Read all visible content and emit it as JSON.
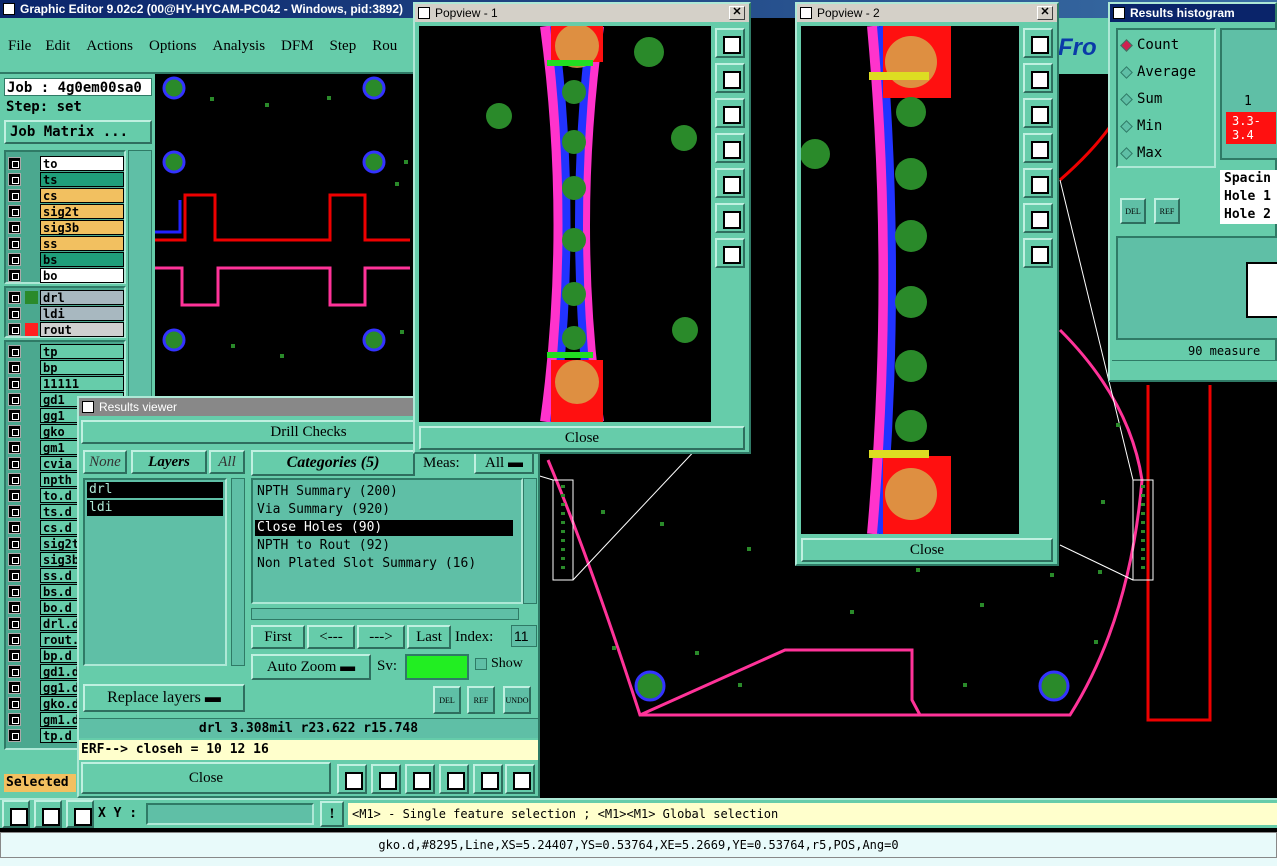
{
  "app": {
    "title": "Graphic Editor 9.02c2 (00@HY-HYCAM-PC042 - Windows, pid:3892)"
  },
  "menu": [
    "File",
    "Edit",
    "Actions",
    "Options",
    "Analysis",
    "DFM",
    "Step",
    "Rou"
  ],
  "job": {
    "label": "Job : 4g0em00sa0",
    "step": "Step: set",
    "matrix_btn": "Job Matrix ...",
    "logo": "Fro"
  },
  "layers_a": [
    {
      "name": "to",
      "color": "#ffffff"
    },
    {
      "name": "ts",
      "color": "#1f9e7a"
    },
    {
      "name": "cs",
      "color": "#f2c060"
    },
    {
      "name": "sig2t",
      "color": "#f2c060"
    },
    {
      "name": "sig3b",
      "color": "#f2c060"
    },
    {
      "name": "ss",
      "color": "#f2c060"
    },
    {
      "name": "bs",
      "color": "#1f9e7a"
    },
    {
      "name": "bo",
      "color": "#ffffff"
    }
  ],
  "layers_b": [
    {
      "name": "drl",
      "color": "#a8b8c0",
      "swatch": "#2a8a2a"
    },
    {
      "name": "ldi",
      "color": "#a8b8c0",
      "swatch": ""
    },
    {
      "name": "rout",
      "color": "#d0d0d0",
      "swatch": "#ff2020"
    }
  ],
  "layers_c": [
    "tp",
    "bp",
    "11111",
    "gd1",
    "gg1",
    "gko",
    "gm1",
    "cvia",
    "npth",
    "to.d",
    "ts.d",
    "cs.d",
    "sig2t",
    "sig3b",
    "ss.d",
    "bs.d",
    "bo.d",
    "drl.d",
    "rout.",
    "bp.d",
    "gd1.d",
    "gg1.d",
    "gko.d",
    "gm1.d",
    "tp.d"
  ],
  "selected_label": "Selected :",
  "results": {
    "title": "Results viewer",
    "section": "Drill Checks",
    "none": "None",
    "layers": "Layers",
    "all": "All",
    "categories": "Categories (5)",
    "meas_label": "Meas:",
    "meas_value": "All",
    "layer_items": [
      "drl",
      "ldi"
    ],
    "category_items": [
      "NPTH Summary (200)",
      "Via Summary (920)",
      "Close Holes (90)",
      "NPTH to Rout (92)",
      "Non Plated Slot Summary (16)"
    ],
    "nav": {
      "first": "First",
      "prev": "<---",
      "next": "--->",
      "last": "Last",
      "index_label": "Index:",
      "index_value": "11"
    },
    "auto_zoom": "Auto Zoom",
    "sv_label": "Sv:",
    "show_label": "Show",
    "replace": "Replace layers",
    "del": "DEL",
    "ref": "REF",
    "undo": "UNDO",
    "measure": "drl 3.308mil   r23.622   r15.748",
    "erf": "ERF--> closeh = 10 12 16",
    "close": "Close"
  },
  "popview1": {
    "title": "Popview - 1",
    "close": "Close"
  },
  "popview2": {
    "title": "Popview - 2",
    "close": "Close"
  },
  "histogram": {
    "title": "Results histogram",
    "options": [
      "Count",
      "Average",
      "Sum",
      "Min",
      "Max"
    ],
    "bin_label": "1",
    "range": "3.3-\n3.4",
    "lines": [
      "Spacin",
      "Hole 1",
      "Hole 2"
    ],
    "measured": "90 measure",
    "del": "DEL",
    "ref": "REF"
  },
  "status": {
    "xy_label": "X Y :",
    "hint": "<M1> - Single feature selection ; <M1><M1> Global selection",
    "info": "gko.d,#8295,Line,XS=5.24407,YS=0.53764,XE=5.2669,YE=0.53764,r5,POS,Ang=0"
  }
}
